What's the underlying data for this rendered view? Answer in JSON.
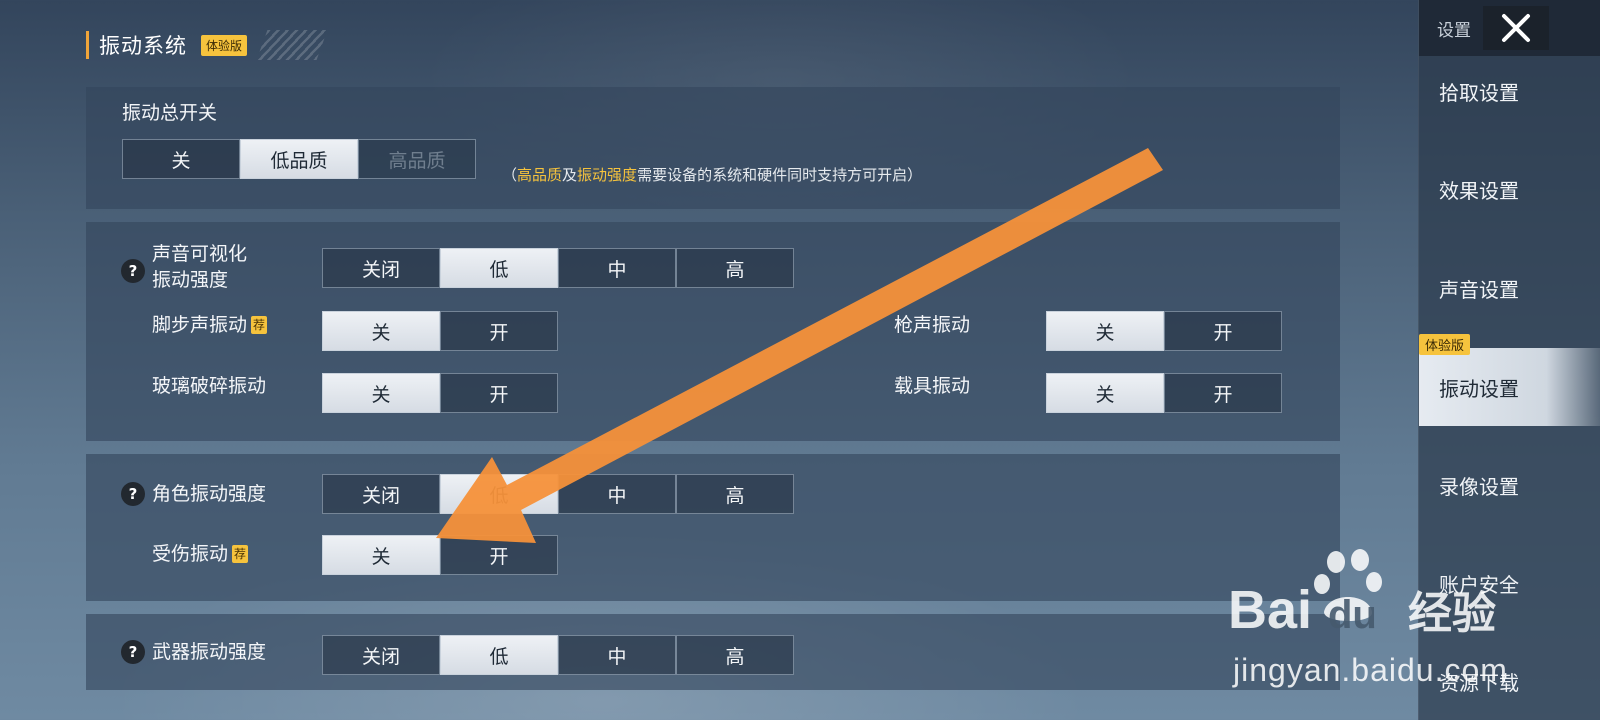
{
  "section": {
    "title": "振动系统",
    "badge": "体验版"
  },
  "master": {
    "label": "振动总开关",
    "options": [
      "关",
      "低品质",
      "高品质"
    ],
    "selected": 1,
    "disabled": [
      2
    ],
    "note": {
      "open": "（",
      "hl1": "高品质",
      "mid": "及",
      "hl2": "振动强度",
      "rest": "需要设备的系统和硬件同时支持方可开启",
      "close": "）"
    }
  },
  "sound_visual": {
    "label_line1": "声音可视化",
    "label_line2": "振动强度",
    "options": [
      "关闭",
      "低",
      "中",
      "高"
    ],
    "selected": 1
  },
  "footstep": {
    "label": "脚步声振动",
    "badge": "荐",
    "options": [
      "关",
      "开"
    ],
    "selected": 0
  },
  "gunshot": {
    "label": "枪声振动",
    "options": [
      "关",
      "开"
    ],
    "selected": 0
  },
  "glass": {
    "label": "玻璃破碎振动",
    "options": [
      "关",
      "开"
    ],
    "selected": 0
  },
  "vehicle": {
    "label": "载具振动",
    "options": [
      "关",
      "开"
    ],
    "selected": 0
  },
  "character": {
    "label": "角色振动强度",
    "options": [
      "关闭",
      "低",
      "中",
      "高"
    ],
    "selected": 1
  },
  "damage": {
    "label": "受伤振动",
    "badge": "荐",
    "options": [
      "关",
      "开"
    ],
    "selected": 0
  },
  "weapon": {
    "label": "武器振动强度",
    "options": [
      "关闭",
      "低",
      "中",
      "高"
    ],
    "selected": 1
  },
  "help_glyph": "?",
  "sidebar": {
    "header": "设置",
    "close_icon": "close-icon",
    "items": [
      {
        "label": "拾取设置"
      },
      {
        "label": "效果设置"
      },
      {
        "label": "声音设置"
      },
      {
        "label": "振动设置",
        "badge": "体验版"
      },
      {
        "label": "录像设置"
      },
      {
        "label": "账户安全"
      },
      {
        "label": "资源下载"
      }
    ],
    "active": 3
  },
  "watermark": {
    "text": "jingyan.baidu.com",
    "logo": "Bai du 经验"
  },
  "colors": {
    "accent": "#f6c33d",
    "arrow": "#f5913a",
    "selected_bg": "#e6ebf1"
  }
}
